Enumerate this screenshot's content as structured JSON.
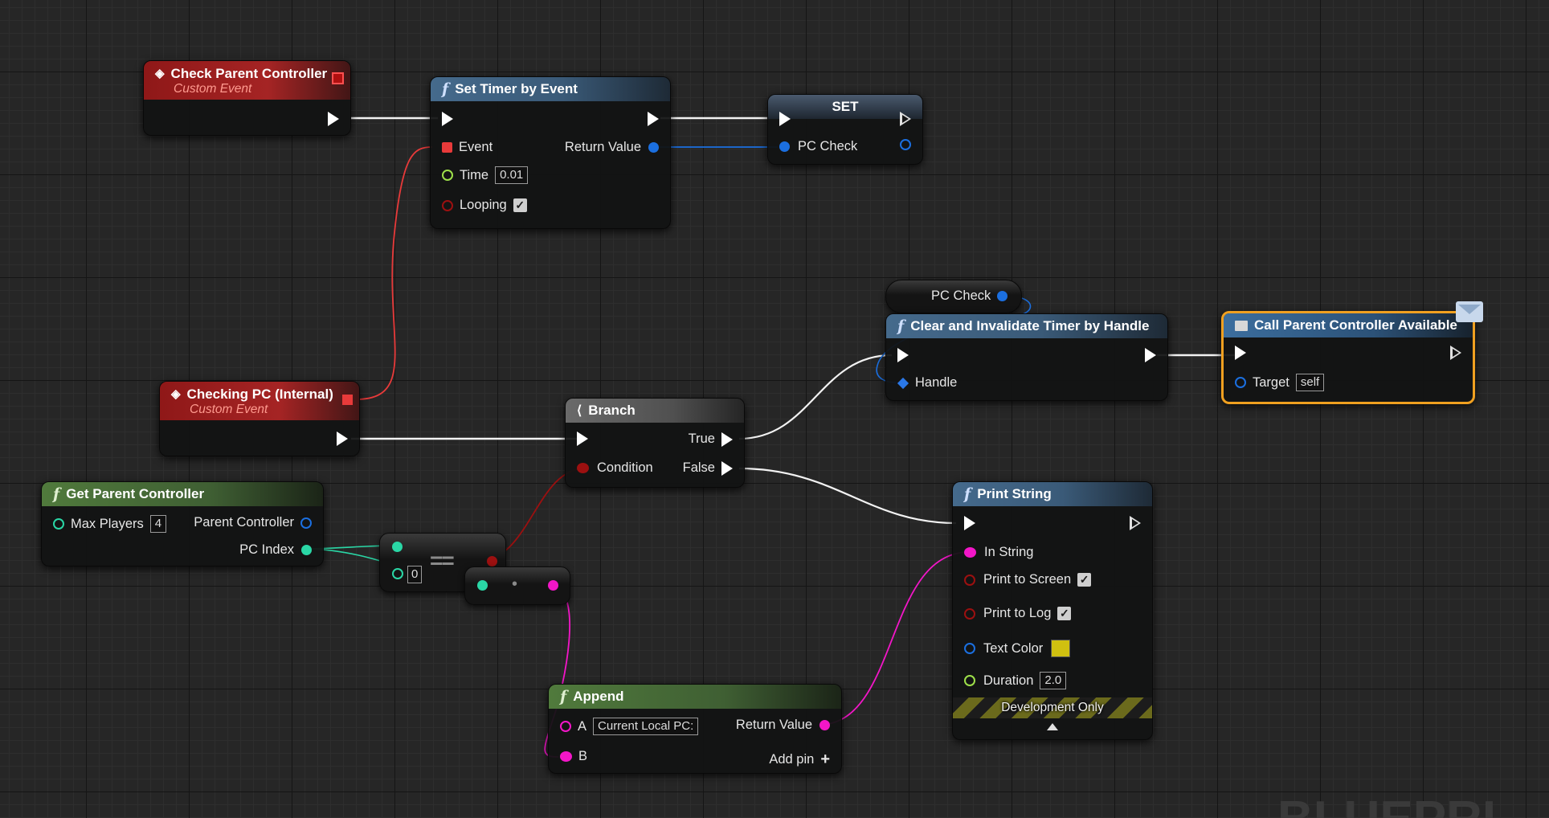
{
  "nodes": {
    "check_parent_controller": {
      "title": "Check Parent Controller",
      "subtitle": "Custom Event"
    },
    "set_timer": {
      "title": "Set Timer by Event",
      "icon": "f",
      "event_label": "Event",
      "return_label": "Return Value",
      "time_label": "Time",
      "time_value": "0.01",
      "looping_label": "Looping",
      "looping_checked": "✓"
    },
    "set_node": {
      "title": "SET",
      "var_label": "PC Check"
    },
    "pc_check_getter": {
      "label": "PC Check"
    },
    "clear_timer": {
      "title": "Clear and Invalidate Timer by Handle",
      "icon": "f",
      "handle_label": "Handle"
    },
    "call_parent": {
      "title": "Call Parent Controller Available",
      "target_label": "Target",
      "target_value": "self"
    },
    "checking_pc": {
      "title": "Checking PC (Internal)",
      "subtitle": "Custom Event"
    },
    "branch": {
      "title": "Branch",
      "true_label": "True",
      "false_label": "False",
      "condition_label": "Condition"
    },
    "get_parent_controller": {
      "title": "Get Parent Controller",
      "icon": "f",
      "max_players_label": "Max Players",
      "max_players_value": "4",
      "parent_controller_label": "Parent Controller",
      "pc_index_label": "PC Index"
    },
    "equals": {
      "symbol": "==",
      "value": "0"
    },
    "to_string": {
      "symbol": "•"
    },
    "append": {
      "title": "Append",
      "icon": "f",
      "a_label": "A",
      "a_value": "Current Local PC:",
      "b_label": "B",
      "return_label": "Return Value",
      "add_pin_label": "Add pin",
      "add_pin_icon": "+"
    },
    "print_string": {
      "title": "Print String",
      "icon": "f",
      "in_string_label": "In String",
      "print_screen_label": "Print to Screen",
      "print_log_label": "Print to Log",
      "text_color_label": "Text Color",
      "duration_label": "Duration",
      "duration_value": "2.0",
      "dev_only_label": "Development Only",
      "check": "✓"
    }
  },
  "colors": {
    "exec": "#ffffff",
    "event": "#e83a3a",
    "float": "#9ee04a",
    "bool": "#9c1010",
    "object": "#1b6fe0",
    "integer": "#2ad7a6",
    "string": "#f316c8",
    "text_color": "#d0c010"
  },
  "watermark": "BLUEPRI"
}
